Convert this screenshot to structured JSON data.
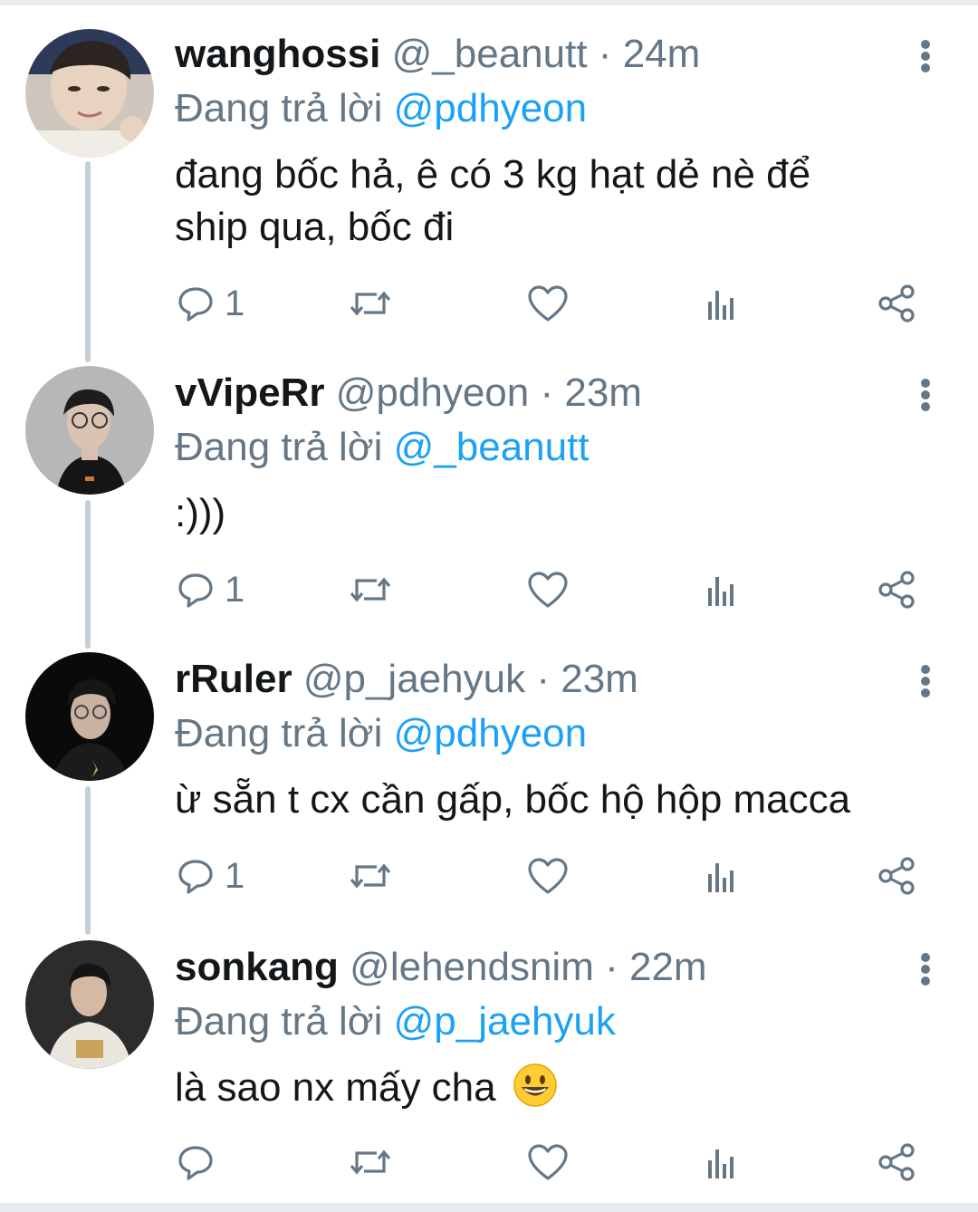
{
  "tweets": [
    {
      "name": "wanghossi",
      "handle": "@_beanutt",
      "dot": "·",
      "time": "24m",
      "reply_prefix": "Đang trả lời",
      "reply_to": "@pdhyeon",
      "text_lines": [
        "đang bốc hả, ê có 3 kg hạt dẻ nè để",
        "ship qua, bốc đi"
      ],
      "reply_count": "1",
      "avatar_bg": "#d9d2cb"
    },
    {
      "name": "vVipeRr",
      "handle": "@pdhyeon",
      "dot": "·",
      "time": "23m",
      "reply_prefix": "Đang trả lời",
      "reply_to": "@_beanutt",
      "text_lines": [
        ":)))"
      ],
      "reply_count": "1",
      "avatar_bg": "#b9b9b9"
    },
    {
      "name": "rRuler",
      "handle": "@p_jaehyuk",
      "dot": "·",
      "time": "23m",
      "reply_prefix": "Đang trả lời",
      "reply_to": "@pdhyeon",
      "text_lines": [
        "ừ sẵn t cx cần gấp, bốc hộ hộp macca"
      ],
      "reply_count": "1",
      "avatar_bg": "#0d0d0d"
    },
    {
      "name": "sonkang",
      "handle": "@lehendsnim",
      "dot": "·",
      "time": "22m",
      "reply_prefix": "Đang trả lời",
      "reply_to": "@p_jaehyuk",
      "text_lines": [
        "là sao nx mấy cha"
      ],
      "reply_count": "",
      "avatar_bg": "#3a3a3a",
      "emoji": "grinning-face"
    }
  ],
  "colors": {
    "name": "#14171a",
    "secondary": "#657786",
    "mention": "#1da1f2",
    "thread_line": "#c4cfd6",
    "icon": "#657786"
  },
  "icons": [
    "reply-icon",
    "retweet-icon",
    "like-icon",
    "analytics-icon",
    "share-icon",
    "more-icon",
    "grinning-face-emoji"
  ]
}
